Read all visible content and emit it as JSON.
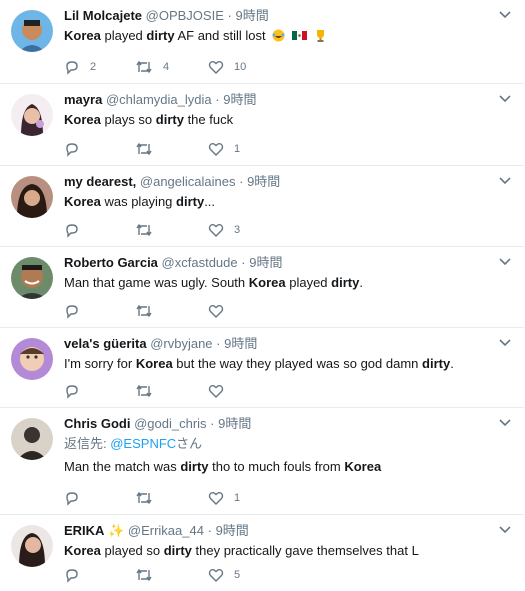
{
  "tweets": [
    {
      "name": "Lil Molcajete",
      "handle": "@OPBJOSIE",
      "dot": "·",
      "time": "9時間",
      "text_parts": [
        "Korea",
        " played ",
        "dirty",
        " AF and still lost"
      ],
      "emojis": [
        "joy-emoji",
        "mexico-flag-emoji",
        "trophy-emoji"
      ],
      "replies": "2",
      "retweets": "4",
      "likes": "10"
    },
    {
      "name": "mayra",
      "handle": "@chlamydia_lydia",
      "dot": "·",
      "time": "9時間",
      "text_parts": [
        "Korea",
        " plays so ",
        "dirty",
        " the fuck"
      ],
      "replies": "",
      "retweets": "",
      "likes": "1"
    },
    {
      "name": "my dearest,",
      "handle": "@angelicalaines",
      "dot": "·",
      "time": "9時間",
      "text_parts": [
        "Korea",
        " was playing ",
        "dirty",
        "..."
      ],
      "replies": "",
      "retweets": "",
      "likes": "3"
    },
    {
      "name": "Roberto Garcia",
      "handle": "@xcfastdude",
      "dot": "·",
      "time": "9時間",
      "text_parts": [
        "Man that game was ugly. South ",
        "Korea",
        " played ",
        "dirty",
        "."
      ],
      "replies": "",
      "retweets": "",
      "likes": ""
    },
    {
      "name": "vela's güerita",
      "handle": "@rvbyjane",
      "dot": "·",
      "time": "9時間",
      "text_parts": [
        "I'm sorry for ",
        "Korea",
        " but the way they played was so god damn ",
        "dirty",
        "."
      ],
      "replies": "",
      "retweets": "",
      "likes": ""
    },
    {
      "name": "Chris Godi",
      "handle": "@godi_chris",
      "dot": "·",
      "time": "9時間",
      "reply_prefix": "返信先: ",
      "reply_mention": "@ESPNFC",
      "reply_suffix": "さん",
      "text_parts": [
        "Man the match was ",
        "dirty",
        " tho to much fouls from ",
        "Korea"
      ],
      "replies": "",
      "retweets": "",
      "likes": "1"
    },
    {
      "name": "ERIKA",
      "name_emoji": "✨",
      "handle": "@Errikaa_44",
      "dot": "·",
      "time": "9時間",
      "text_parts": [
        "Korea",
        " played so ",
        "dirty",
        " they practically gave themselves that L"
      ],
      "replies": "",
      "retweets": "",
      "likes": "5"
    }
  ],
  "colors": {
    "text": "#14171a",
    "muted": "#657786",
    "link": "#1da1f2",
    "divider": "#e6ecf0"
  }
}
